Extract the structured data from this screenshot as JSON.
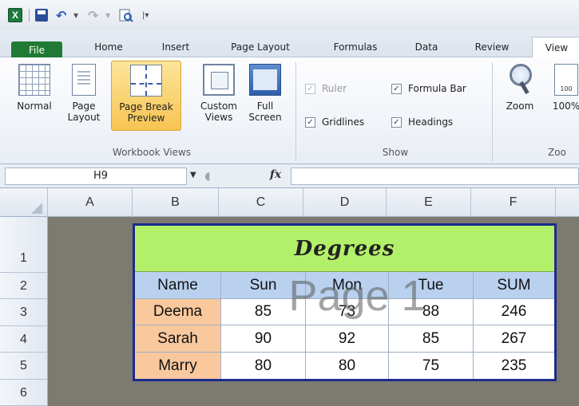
{
  "qat": {
    "icons": [
      "excel-logo-icon",
      "save-icon",
      "undo-icon",
      "redo-icon",
      "print-preview-icon",
      "customize-qat-icon"
    ],
    "app_letter": "X"
  },
  "tabs": [
    {
      "label": "File"
    },
    {
      "label": "Home"
    },
    {
      "label": "Insert"
    },
    {
      "label": "Page Layout"
    },
    {
      "label": "Formulas"
    },
    {
      "label": "Data"
    },
    {
      "label": "Review"
    },
    {
      "label": "View"
    }
  ],
  "ribbon": {
    "workbook_views": {
      "label": "Workbook Views",
      "normal": "Normal",
      "page_layout_1": "Page",
      "page_layout_2": "Layout",
      "page_break_1": "Page Break",
      "page_break_2": "Preview",
      "custom_1": "Custom",
      "custom_2": "Views",
      "full_1": "Full",
      "full_2": "Screen"
    },
    "show": {
      "label": "Show",
      "ruler": "Ruler",
      "formula_bar": "Formula Bar",
      "gridlines": "Gridlines",
      "headings": "Headings",
      "check": "✓"
    },
    "zoom": {
      "label": "Zoo",
      "zoom": "Zoom",
      "hundred": "100%",
      "icon_num": "100"
    }
  },
  "formula_bar": {
    "name_box": "H9",
    "fx": "fx",
    "value": ""
  },
  "columns": [
    "A",
    "B",
    "C",
    "D",
    "E",
    "F"
  ],
  "rows": [
    "1",
    "2",
    "3",
    "4",
    "5",
    "6"
  ],
  "table": {
    "title": "Degrees",
    "headers": [
      "Name",
      "Sun",
      "Mon",
      "Tue",
      "SUM"
    ],
    "data": [
      [
        "Deema",
        "85",
        "73",
        "88",
        "246"
      ],
      [
        "Sarah",
        "90",
        "92",
        "85",
        "267"
      ],
      [
        "Marry",
        "80",
        "80",
        "75",
        "235"
      ]
    ]
  },
  "watermark": "Page 1",
  "colors": {
    "title_fill": "#b3f06a",
    "header_fill": "#b9d1ee",
    "name_fill": "#f9c89c",
    "table_border": "#1b2c8c",
    "file_tab": "#217a34",
    "selected_button": "#f7c452"
  }
}
